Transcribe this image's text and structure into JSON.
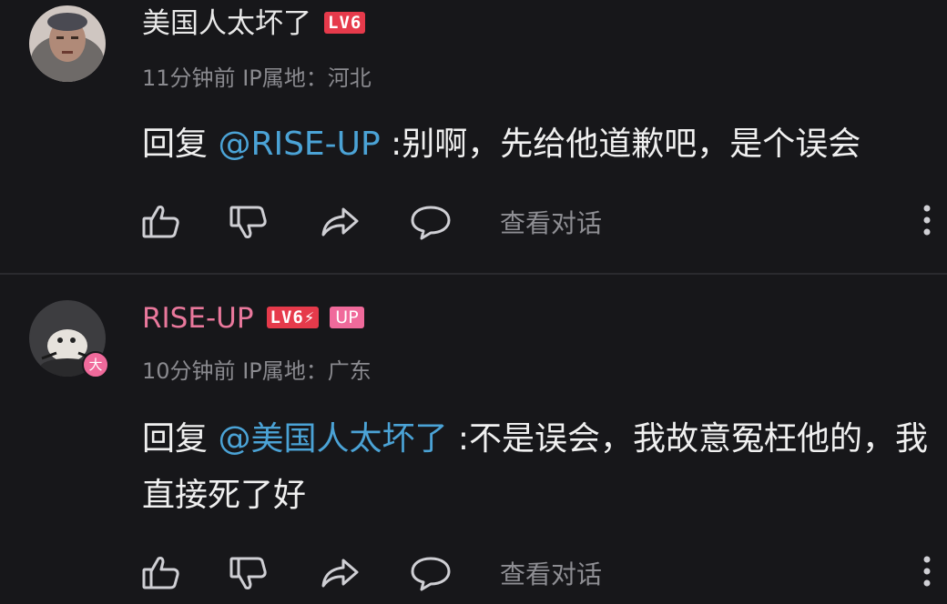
{
  "comments": [
    {
      "username": "美国人太坏了",
      "level": "LV6",
      "time": "11分钟前",
      "location": "IP属地：河北",
      "reply_prefix": "回复 ",
      "mention": "@RISE-UP",
      "text": " :别啊，先给他道歉吧，是个误会",
      "view_conversation": "查看对话"
    },
    {
      "username": "RISE-UP",
      "level": "LV6⚡",
      "up_badge": "UP",
      "avatar_badge": "大",
      "time": "10分钟前",
      "location": "IP属地：广东",
      "reply_prefix": "回复 ",
      "mention": "@美国人太坏了",
      "text": " :不是误会，我故意冤枉他的，我直接死了好",
      "view_conversation": "查看对话"
    }
  ],
  "icons": [
    "like-icon",
    "dislike-icon",
    "share-icon",
    "reply-icon",
    "more-icon"
  ]
}
